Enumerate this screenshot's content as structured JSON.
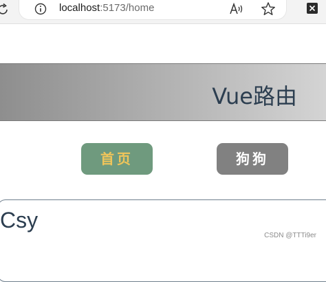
{
  "browser": {
    "url_host": "localhost",
    "url_rest": ":5173/home"
  },
  "header": {
    "title": "Vue路由"
  },
  "nav": {
    "home_label": "首页",
    "dog_label": "狗狗"
  },
  "content": {
    "text": "Csy"
  },
  "watermark": "CSDN @TTTi9er",
  "colors": {
    "home_button_bg": "#6f9a7e",
    "home_button_text": "#f0c55a",
    "dog_button_bg": "#818181",
    "title_text": "#2c3e50"
  }
}
